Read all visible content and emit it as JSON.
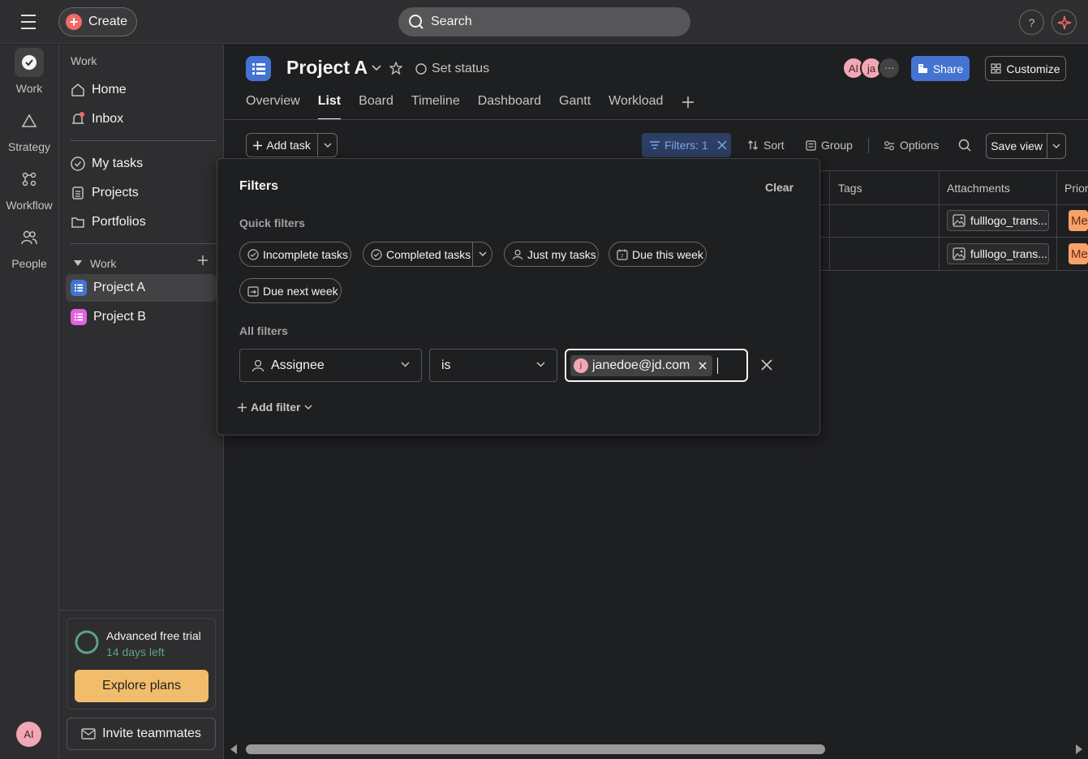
{
  "topbar": {
    "create_label": "Create",
    "search_placeholder": "Search",
    "help_label": "?"
  },
  "rail": {
    "items": [
      {
        "label": "Work"
      },
      {
        "label": "Strategy"
      },
      {
        "label": "Workflow"
      },
      {
        "label": "People"
      }
    ],
    "avatar_initials": "AI"
  },
  "sidebar": {
    "header": "Work",
    "nav": [
      {
        "label": "Home"
      },
      {
        "label": "Inbox"
      },
      {
        "label": "My tasks"
      },
      {
        "label": "Projects"
      },
      {
        "label": "Portfolios"
      }
    ],
    "section_label": "Work",
    "projects": [
      {
        "label": "Project A",
        "color": "#4573d2"
      },
      {
        "label": "Project B",
        "color": "#e362e3"
      }
    ],
    "trial": {
      "title": "Advanced free trial",
      "subtitle": "14 days left",
      "button": "Explore plans"
    },
    "invite_label": "Invite teammates"
  },
  "project": {
    "title": "Project A",
    "set_status": "Set status",
    "avatars": [
      "AI",
      "ja"
    ],
    "share_label": "Share",
    "customize_label": "Customize",
    "tabs": [
      "Overview",
      "List",
      "Board",
      "Timeline",
      "Dashboard",
      "Gantt",
      "Workload"
    ],
    "active_tab": "List"
  },
  "toolbar": {
    "add_task": "Add task",
    "filters_label": "Filters: 1",
    "sort": "Sort",
    "group": "Group",
    "options": "Options",
    "save_view": "Save view"
  },
  "table": {
    "columns": [
      "Tags",
      "Attachments",
      "Prior"
    ],
    "rows": [
      {
        "attachment": "fulllogo_trans...",
        "priority": "Me"
      },
      {
        "attachment": "fulllogo_trans...",
        "priority": "Me"
      }
    ]
  },
  "filters_popover": {
    "title": "Filters",
    "clear": "Clear",
    "quick_label": "Quick filters",
    "quick_filters": [
      "Incomplete tasks",
      "Completed tasks",
      "Just my tasks",
      "Due this week",
      "Due next week"
    ],
    "all_label": "All filters",
    "field": "Assignee",
    "operator": "is",
    "value": "janedoe@jd.com",
    "value_avatar": "j",
    "add_filter": "Add filter"
  },
  "colors": {
    "accent_blue": "#4573d2",
    "brand_coral": "#f06a6a",
    "trial_button": "#f1bd6c",
    "priority_medium": "#f8a26b"
  }
}
